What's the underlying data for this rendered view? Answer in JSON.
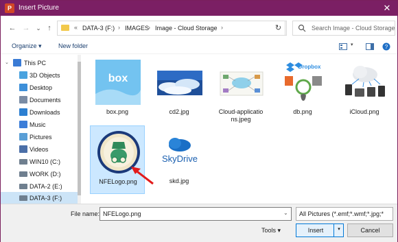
{
  "window": {
    "title": "Insert Picture",
    "app_icon_letter": "P",
    "close_glyph": "✕"
  },
  "nav": {
    "back_glyph": "←",
    "forward_glyph": "→",
    "dropdown_glyph": "⌄",
    "up_glyph": "↑",
    "breadcrumb": [
      "«",
      "DATA-3 (F:)",
      "›",
      "IMAGES",
      "›",
      "Image - Cloud Storage",
      "›"
    ],
    "refresh_glyph": "↻",
    "search_placeholder": "Search Image - Cloud Storage"
  },
  "toolbar": {
    "organize": "Organize ▾",
    "new_folder": "New folder"
  },
  "sidebar": {
    "items": [
      {
        "label": "This PC",
        "icon": "pc-icon",
        "color": "#3a7bd5"
      },
      {
        "label": "3D Objects",
        "icon": "cube-icon",
        "color": "#4aa3df"
      },
      {
        "label": "Desktop",
        "icon": "desktop-icon",
        "color": "#3d8fd9"
      },
      {
        "label": "Documents",
        "icon": "document-icon",
        "color": "#7a8ca5"
      },
      {
        "label": "Downloads",
        "icon": "download-icon",
        "color": "#2c7fd1"
      },
      {
        "label": "Music",
        "icon": "music-icon",
        "color": "#3b7dd8"
      },
      {
        "label": "Pictures",
        "icon": "pictures-icon",
        "color": "#5a9fd6"
      },
      {
        "label": "Videos",
        "icon": "video-icon",
        "color": "#4b6fa8"
      },
      {
        "label": "WIN10 (C:)",
        "icon": "drive-icon",
        "color": "#6f7f8f"
      },
      {
        "label": "WORK (D:)",
        "icon": "drive-icon",
        "color": "#6f7f8f"
      },
      {
        "label": "DATA-2 (E:)",
        "icon": "drive-icon",
        "color": "#6f7f8f"
      },
      {
        "label": "DATA-3 (F:)",
        "icon": "drive-icon",
        "color": "#6f7f8f"
      }
    ]
  },
  "files": [
    {
      "name": "box.png",
      "thumb": "box-icon"
    },
    {
      "name": "cd2.jpg",
      "thumb": "clouds-icon"
    },
    {
      "name": "Cloud-applicationsns.jpeg",
      "name_line1": "Cloud-applicatio",
      "name_line2": "ns.jpeg",
      "thumb": "cloud-diagram-icon"
    },
    {
      "name": "db.png",
      "thumb": "dropbox-icon",
      "thumb_text": "Dropbox"
    },
    {
      "name": "iCloud.png",
      "thumb": "icloud-icon"
    },
    {
      "name": "NFELogo.png",
      "thumb": "nfe-logo-icon"
    },
    {
      "name": "skd.jpg",
      "thumb": "skydrive-icon",
      "thumb_text": "SkyDrive"
    }
  ],
  "bottom": {
    "file_name_label": "File name:",
    "file_name_value": "NFELogo.png",
    "filter": "All Pictures (*.emf;*.wmf;*.jpg;*",
    "tools": "Tools  ▾",
    "insert": "Insert",
    "insert_split": "▾",
    "cancel": "Cancel"
  },
  "colors": {
    "titlebar": "#7b1f64",
    "selection": "#cce8ff",
    "arrow": "#e21b1b"
  }
}
